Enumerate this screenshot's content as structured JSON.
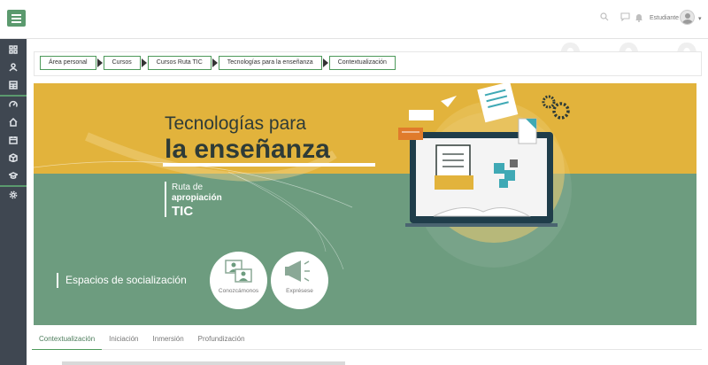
{
  "topbar": {
    "menu_icon": "hamburger-icon",
    "icons": [
      "search-icon",
      "chat-icon",
      "bell-icon"
    ],
    "user_name": "Estudiante",
    "accent": "#5b9a6e"
  },
  "sidebar": {
    "items": [
      "dashboard-icon",
      "user-icon",
      "calendar-grid-icon",
      "speedometer-icon",
      "home-icon",
      "calendar-icon",
      "box-icon",
      "graduation-cap-icon",
      "gear-icon"
    ],
    "background": "#3f4751"
  },
  "decor": {
    "binary_top": "0 0 0 1 1",
    "binary_side": "1"
  },
  "breadcrumb": [
    "Área personal",
    "Cursos",
    "Cursos Ruta TIC",
    "Tecnologías para la enseñanza",
    "Contextualización"
  ],
  "banner": {
    "title_line1": "Tecnologías para",
    "title_line2": "la enseñanza",
    "ruta_line1": "Ruta de",
    "ruta_line2": "apropiación",
    "ruta_line3": "TIC",
    "social_label": "Espacios de socialización",
    "buttons": [
      {
        "label": "Conozcámonos",
        "icon": "people-icon"
      },
      {
        "label": "Exprésese",
        "icon": "megaphone-icon"
      }
    ],
    "yellow": "#e2b33c",
    "green": "#6d9c7f"
  },
  "tabs": [
    "Contextualización",
    "Iniciación",
    "Inmersión",
    "Profundización"
  ]
}
